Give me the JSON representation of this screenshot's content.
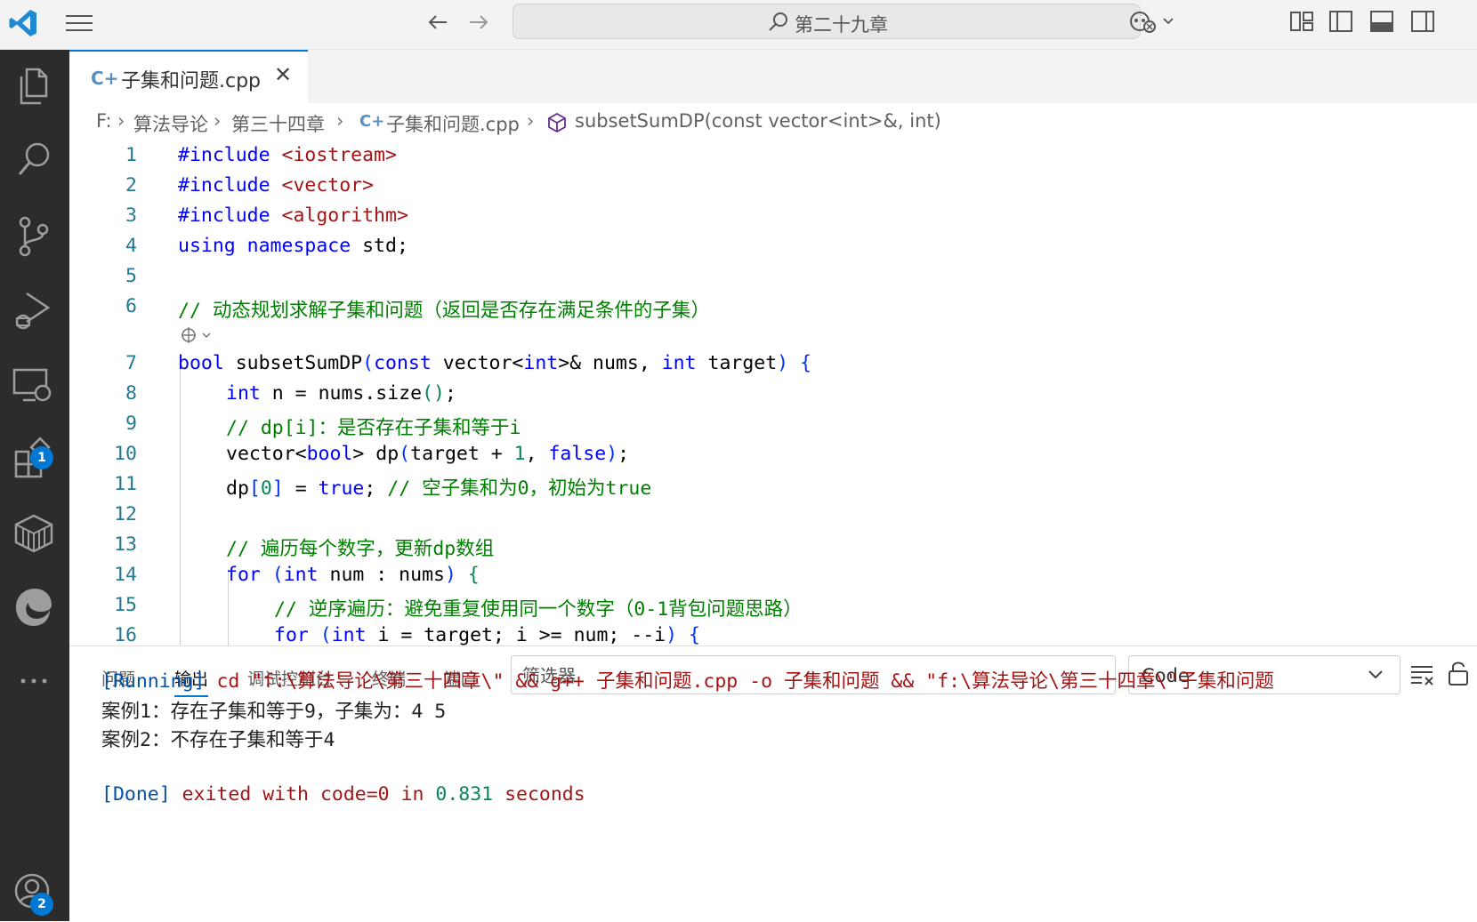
{
  "titlebar": {
    "search_text": "第二十九章"
  },
  "editor": {
    "tab_label": "子集和问题.cpp",
    "breadcrumb": [
      "F:",
      "算法导论",
      "第三十四章",
      "子集和问题.cpp",
      "subsetSumDP(const vector<int>&, int)"
    ],
    "line_numbers": [
      "1",
      "2",
      "3",
      "4",
      "5",
      "6",
      "7",
      "8",
      "9",
      "10",
      "11",
      "12",
      "13",
      "14",
      "15",
      "16"
    ],
    "lines": {
      "l1a": "#include ",
      "l1b": "<iostream>",
      "l2a": "#include ",
      "l2b": "<vector>",
      "l3a": "#include ",
      "l3b": "<algorithm>",
      "l4a": "using namespace",
      "l4b": " std;",
      "l6": "// 动态规划求解子集和问题（返回是否存在满足条件的子集）",
      "l7a": "bool",
      "l7b": " subsetSumDP",
      "l7c": "(",
      "l7d": "const",
      "l7e": " vector<",
      "l7f": "int",
      "l7g": ">& nums, ",
      "l7h": "int",
      "l7i": " target",
      "l7j": ")",
      "l7k": " {",
      "l8a": "int",
      "l8b": " n = nums.size",
      "l8c": "()",
      "l8d": ";",
      "l9": "// dp[i]：是否存在子集和等于i",
      "l10a": "vector<",
      "l10b": "bool",
      "l10c": "> dp",
      "l10d": "(",
      "l10e": "target + ",
      "l10f": "1",
      "l10g": ", ",
      "l10h": "false",
      "l10i": ")",
      "l10j": ";",
      "l11a": "dp",
      "l11b": "[",
      "l11c": "0",
      "l11d": "]",
      "l11e": " = ",
      "l11f": "true",
      "l11g": "; ",
      "l11h": "// 空子集和为0，初始为true",
      "l13": "// 遍历每个数字，更新dp数组",
      "l14a": "for",
      "l14b": " (",
      "l14c": "int",
      "l14d": " num : nums",
      "l14e": ")",
      "l14f": " {",
      "l15": "// 逆序遍历：避免重复使用同一个数字（0-1背包问题思路）",
      "l16a": "for",
      "l16b": " (",
      "l16c": "int",
      "l16d": " i = target; i >= num; --i",
      "l16e": ")",
      "l16f": " {"
    }
  },
  "panel": {
    "tabs": [
      "问题",
      "输出",
      "调试控制台",
      "终端",
      "端口"
    ],
    "filter_placeholder": "筛选器",
    "channel": "Code",
    "output": {
      "run_tag": "[Running]",
      "run_cmd": " cd \"f:\\算法导论\\第三十四章\\\" && g++ 子集和问题.cpp -o 子集和问题 && \"f:\\算法导论\\第三十四章\\\"子集和问题",
      "case1": "案例1：存在子集和等于9，子集为：4 5",
      "case2": "案例2：不存在子集和等于4",
      "done_tag": "[Done]",
      "done_a": " exited with ",
      "done_b": "code=0",
      "done_c": " in ",
      "done_d": "0.831",
      "done_e": " seconds"
    }
  },
  "activity_badges": {
    "extensions": "1",
    "accounts": "2"
  }
}
